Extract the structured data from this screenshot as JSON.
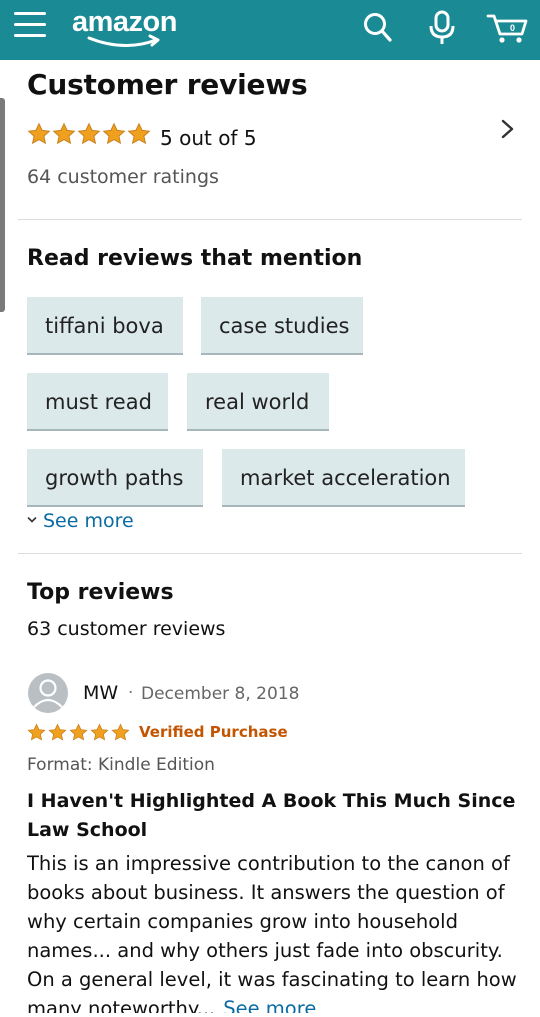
{
  "header": {
    "logo_text": "amazon",
    "bg_color": "#1a8a94",
    "icons": [
      "hamburger-menu-icon",
      "search-icon",
      "microphone-icon",
      "cart-icon"
    ]
  },
  "summary": {
    "title": "Customer reviews",
    "stars": 5,
    "rating_text": "5 out of 5",
    "ratings_count": "64 customer ratings"
  },
  "mentions": {
    "title": "Read reviews that mention",
    "chips": [
      "tiffani bova",
      "case studies",
      "must read",
      "real world",
      "growth paths",
      "market acceleration"
    ],
    "see_more": "See more"
  },
  "top_reviews": {
    "title": "Top reviews",
    "count": "63 customer reviews"
  },
  "review": {
    "author": "MW",
    "separator": "·",
    "date": "December 8, 2018",
    "stars": 5,
    "verified": "Verified Purchase",
    "format": "Format: Kindle Edition",
    "title": "I Haven't Highlighted A Book This Much Since Law School",
    "body": "This is an impressive contribution to the canon of books about business. It answers the question of why certain companies grow into household names... and why others just fade into obscurity. On a general level, it was fascinating to learn how many noteworthy...",
    "see_more": "See more"
  },
  "colors": {
    "star": "#f0a01f",
    "link": "#0a6ba3",
    "verified": "#c45500",
    "chip_bg": "#dce9ea"
  }
}
